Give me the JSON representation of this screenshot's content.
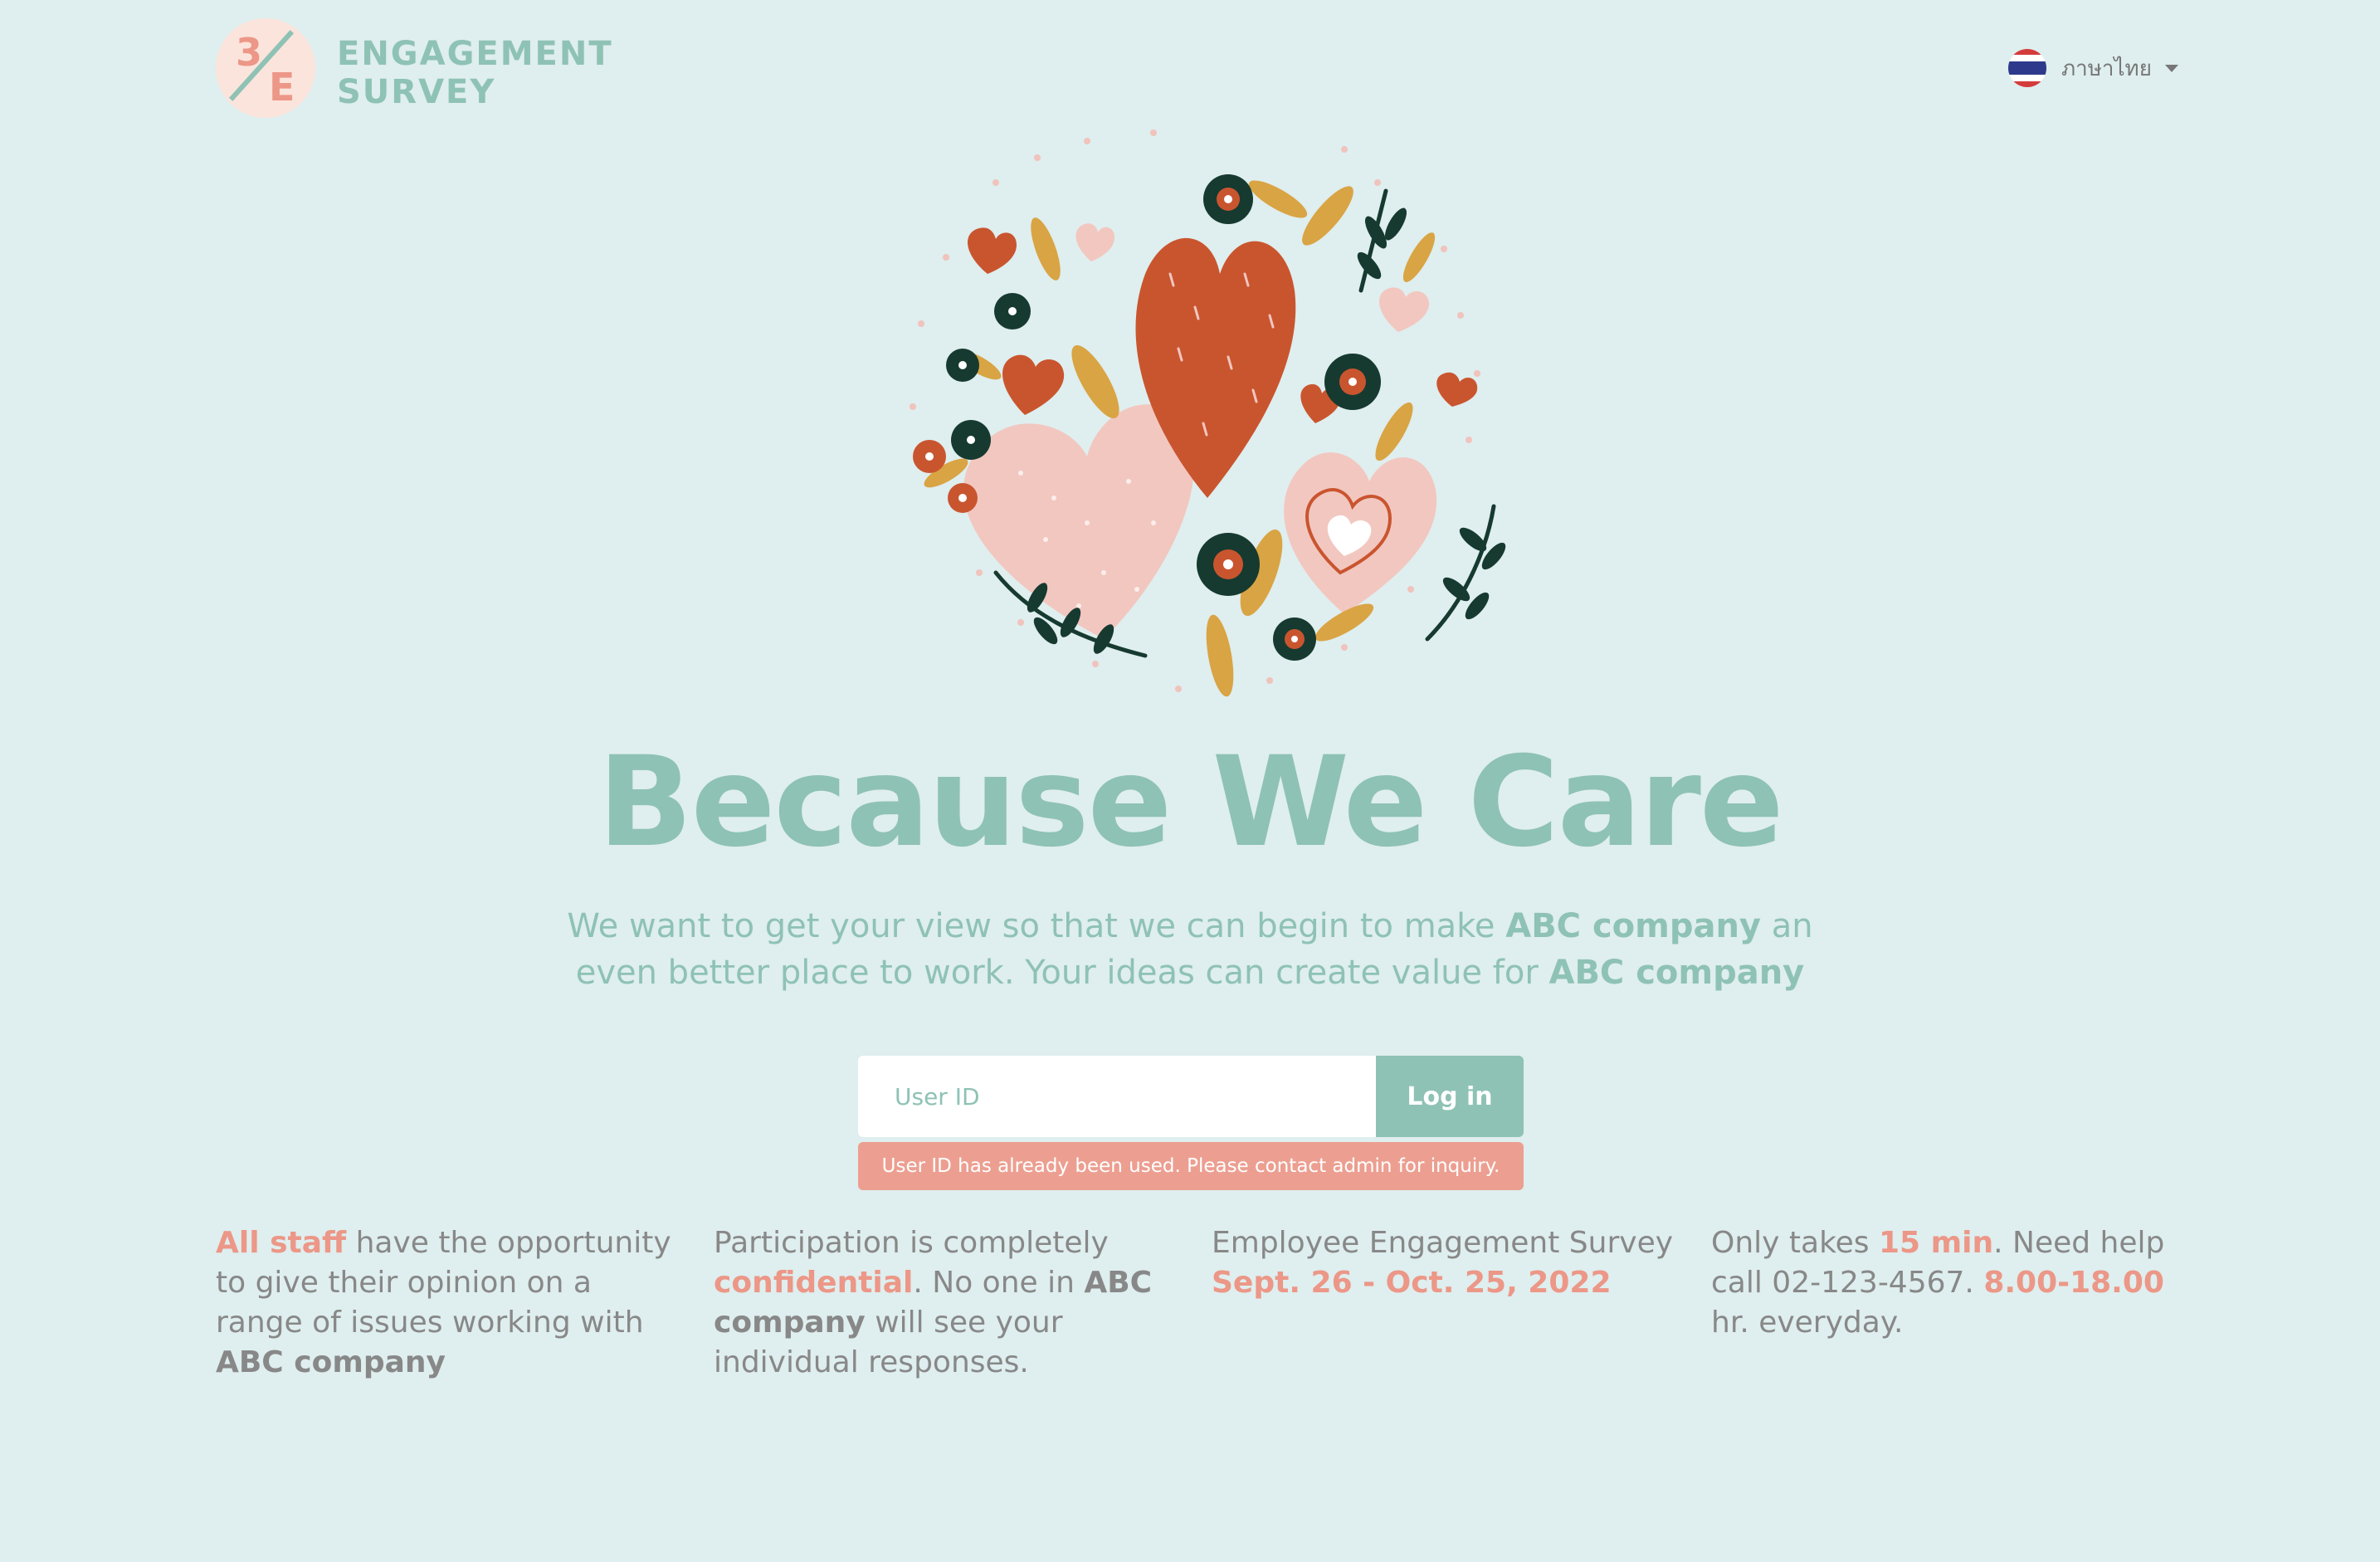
{
  "brand": {
    "mark_top": "3",
    "mark_bottom": "E",
    "line1": "ENGAGEMENT",
    "line2": "SURVEY"
  },
  "language": {
    "label": "ภาษาไทย",
    "flag_icon": "thailand-flag-icon"
  },
  "hero": {
    "title": "Because We Care",
    "subtitle_1": "We want to get your view so that we can begin to make ",
    "subtitle_company_1": "ABC company",
    "subtitle_2": " an even better place to work. Your ideas can create value for ",
    "subtitle_company_2": "ABC company"
  },
  "login": {
    "placeholder": "User ID",
    "button": "Log in",
    "error": "User ID has already been used. Please contact admin for inquiry."
  },
  "info": {
    "col1": {
      "hl": "All staff",
      "text": " have the opportunity to give their opinion on a range of issues working with ",
      "company": "ABC company"
    },
    "col2": {
      "pre": "Participation is completely ",
      "hl": "confidential",
      "mid": ". No one in ",
      "company": "ABC company",
      "post": " will see your individual responses."
    },
    "col3": {
      "text": "Employee Engagement Survey",
      "hl": "Sept. 26 - Oct. 25, 2022"
    },
    "col4": {
      "pre": "Only takes ",
      "hl1": "15 min",
      "mid": ". Need help call 02-123-4567. ",
      "hl2": "8.00-18.00",
      "post": " hr. everyday."
    }
  },
  "colors": {
    "background": "#dfeeee",
    "teal": "#8ec2b4",
    "coral": "#ec9787",
    "text": "#888888"
  }
}
